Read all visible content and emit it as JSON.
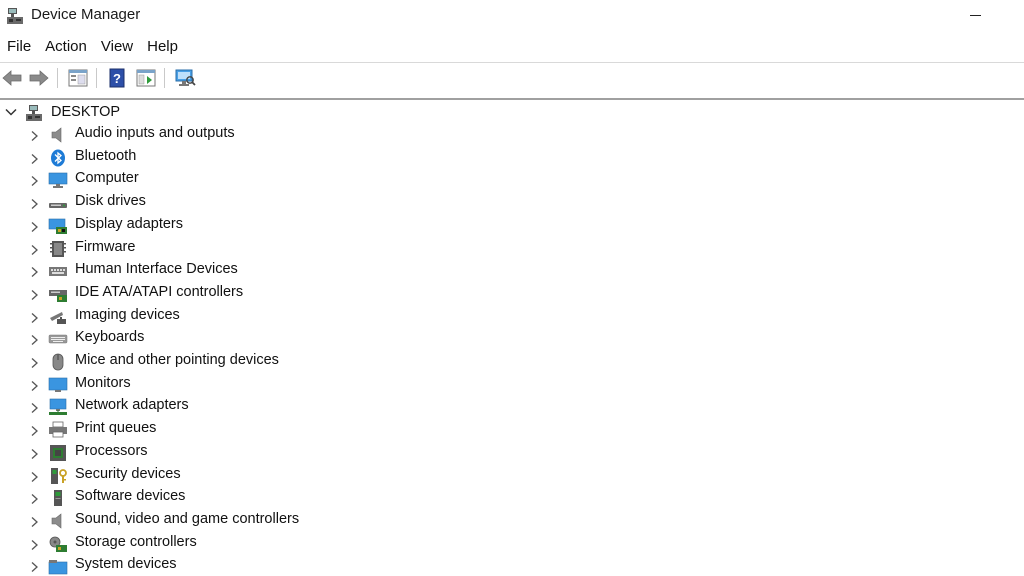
{
  "window": {
    "title": "Device Manager"
  },
  "menu": [
    "File",
    "Action",
    "View",
    "Help"
  ],
  "toolbar": {
    "buttons": [
      "back-icon",
      "forward-icon",
      "properties-icon",
      "help-icon",
      "update-driver-icon",
      "scan-hardware-icon"
    ]
  },
  "tree": {
    "root": {
      "label": "DESKTOP",
      "icon": "computer-icon"
    },
    "categories": [
      {
        "label": "Audio inputs and outputs",
        "icon": "speaker-icon"
      },
      {
        "label": "Bluetooth",
        "icon": "bluetooth-icon"
      },
      {
        "label": "Computer",
        "icon": "monitor-icon"
      },
      {
        "label": "Disk drives",
        "icon": "disk-drive-icon"
      },
      {
        "label": "Display adapters",
        "icon": "display-adapter-icon"
      },
      {
        "label": "Firmware",
        "icon": "firmware-icon"
      },
      {
        "label": "Human Interface Devices",
        "icon": "hid-icon"
      },
      {
        "label": "IDE ATA/ATAPI controllers",
        "icon": "ide-controller-icon"
      },
      {
        "label": "Imaging devices",
        "icon": "camera-icon"
      },
      {
        "label": "Keyboards",
        "icon": "keyboard-icon"
      },
      {
        "label": "Mice and other pointing devices",
        "icon": "mouse-icon"
      },
      {
        "label": "Monitors",
        "icon": "monitor-icon"
      },
      {
        "label": "Network adapters",
        "icon": "network-adapter-icon"
      },
      {
        "label": "Print queues",
        "icon": "printer-icon"
      },
      {
        "label": "Processors",
        "icon": "processor-icon"
      },
      {
        "label": "Security devices",
        "icon": "security-device-icon"
      },
      {
        "label": "Software devices",
        "icon": "software-device-icon"
      },
      {
        "label": "Sound, video and game controllers",
        "icon": "speaker-icon"
      },
      {
        "label": "Storage controllers",
        "icon": "storage-controller-icon"
      },
      {
        "label": "System devices",
        "icon": "system-devices-icon"
      }
    ]
  },
  "colors": {
    "accent_blue": "#1e7bd6",
    "green": "#2e9b3a",
    "gray": "#6b6b6b"
  }
}
